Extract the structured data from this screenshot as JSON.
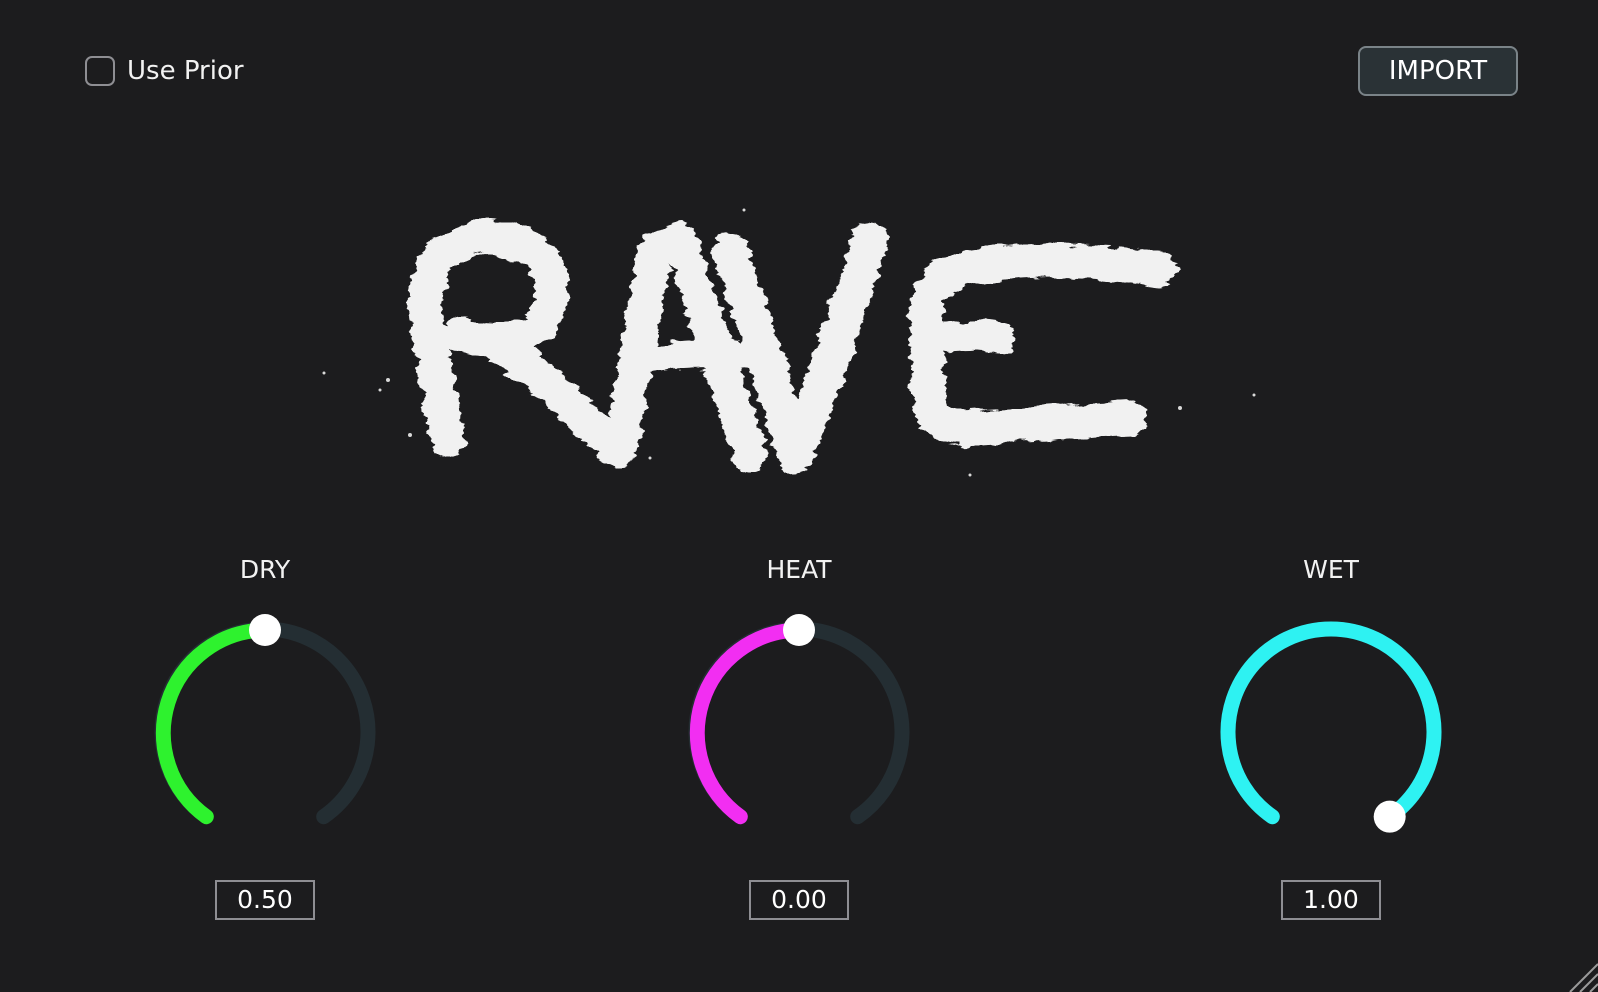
{
  "header": {
    "use_prior": {
      "label": "Use Prior",
      "checked": false
    },
    "import_label": "IMPORT"
  },
  "logo": {
    "text": "RAVE"
  },
  "knobs": [
    {
      "id": "dry",
      "label": "DRY",
      "value": "0.50",
      "fraction": 0.5,
      "color": "#2ef22e"
    },
    {
      "id": "heat",
      "label": "HEAT",
      "value": "0.00",
      "fraction": 0.5,
      "color": "#f22ef2"
    },
    {
      "id": "wet",
      "label": "WET",
      "value": "1.00",
      "fraction": 1.0,
      "color": "#2ef2f2"
    }
  ],
  "colors": {
    "background": "#1c1c1e",
    "track": "#242e33",
    "thumb": "#ffffff"
  }
}
